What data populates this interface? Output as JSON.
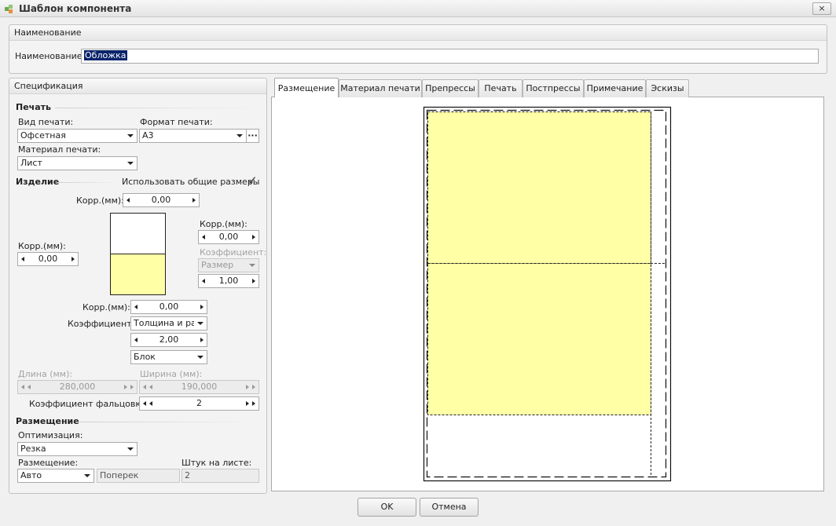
{
  "window": {
    "title": "Шаблон компонента",
    "close_icon": "×"
  },
  "name_group": {
    "header": "Наименование",
    "label": "Наименование:",
    "value": "Обложка"
  },
  "spec": {
    "header": "Спецификация",
    "print": {
      "section": "Печать",
      "print_type_label": "Вид печати:",
      "print_type_value": "Офсетная",
      "print_format_label": "Формат печати:",
      "print_format_value": "А3",
      "more_label": "···",
      "print_material_label": "Материал печати:",
      "print_material_value": "Лист"
    },
    "product": {
      "section": "Изделие",
      "use_common_sizes_label": "Использовать общие размеры",
      "use_common_sizes_checked": true,
      "check_mark": "✓",
      "top_corr_label": "Корр.(мм):",
      "top_corr_value": "0,00",
      "right_corr_label": "Корр.(мм):",
      "right_corr_value": "0,00",
      "right_coef_label": "Коэффициент:",
      "right_coef_combo": "Размер",
      "right_coef_value": "1,00",
      "left_corr_label": "Корр.(мм):",
      "left_corr_value": "0,00",
      "bottom_corr_label": "Корр.(мм):",
      "bottom_corr_value": "0,00",
      "coef_label": "Коэффициент:",
      "coef_combo": "Толщина и размер",
      "coef_value": "2,00",
      "block_combo": "Блок",
      "length_label": "Длина (мм):",
      "length_value": "280,000",
      "width_label": "Ширина (мм):",
      "width_value": "190,000",
      "fold_coef_label": "Коэффициент фальцовки:",
      "fold_coef_value": "2"
    },
    "placement": {
      "section": "Размещение",
      "optimization_label": "Оптимизация:",
      "optimization_value": "Резка",
      "placement_label": "Размещение:",
      "placement_value": "Авто",
      "orientation_value": "Поперек",
      "per_sheet_label": "Штук на листе:",
      "per_sheet_value": "2"
    }
  },
  "tabs": [
    "Размещение",
    "Материал печати",
    "Препрессы",
    "Печать",
    "Постпрессы",
    "Примечание",
    "Эскизы"
  ],
  "active_tab": 0,
  "colors": {
    "product_fill": "#ffffa6",
    "accent_selection": "#0a246a"
  },
  "buttons": {
    "ok": "OK",
    "cancel": "Отмена"
  }
}
